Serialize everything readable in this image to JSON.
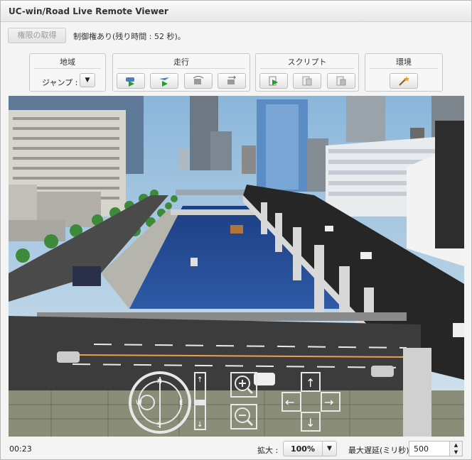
{
  "window": {
    "title": "UC-win/Road Live Remote Viewer"
  },
  "auth": {
    "button_label": "権限の取得",
    "status_text": "制御権あり(残り時間 : 52 秒)。"
  },
  "panels": {
    "region": {
      "title": "地域",
      "jump_label": "ジャンプ :",
      "dropdown_icon": "triangle-down"
    },
    "drive": {
      "title": "走行",
      "buttons": [
        "play-car-icon",
        "play-plane-icon",
        "car-settings-icon",
        "car-swap-icon"
      ]
    },
    "script": {
      "title": "スクリプト",
      "buttons": [
        "play-script-icon",
        "script-pause-icon",
        "script-stop-icon"
      ]
    },
    "environment": {
      "title": "環境",
      "buttons": [
        "magic-wand-icon"
      ]
    }
  },
  "nav_overlay": {
    "compass_letters": [
      "N",
      "E",
      "S",
      "W"
    ],
    "zoom_in_icon": "magnifier-plus-icon",
    "zoom_out_icon": "magnifier-minus-icon",
    "arrows": [
      "up-arrow-icon",
      "down-arrow-icon",
      "left-arrow-icon",
      "right-arrow-icon"
    ]
  },
  "footer": {
    "time": "00:23",
    "zoom_label": "拡大 :",
    "zoom_value": "100%",
    "delay_label": "最大遅延(ミリ秒) :",
    "delay_value": "500"
  },
  "colors": {
    "sky": "#9fc4e0",
    "water": "#2c4a8a",
    "road": "#3a3a3a",
    "accent_green": "#2a9a2a"
  }
}
